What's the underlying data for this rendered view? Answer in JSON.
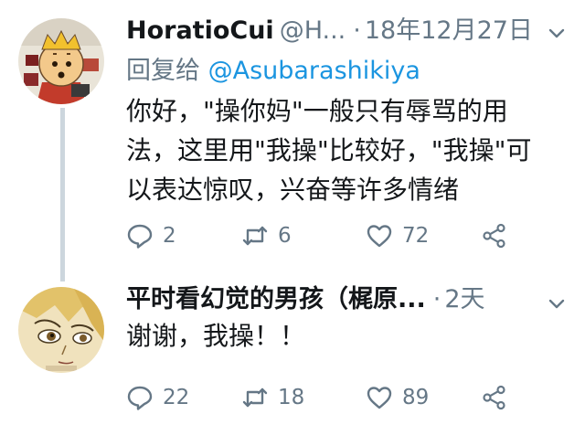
{
  "tweets": [
    {
      "name": "HoratioCui",
      "handle": "@H...",
      "separator": "·",
      "time": "18年12月27日",
      "reply_prefix": "回复给",
      "reply_to": "@Asubarashikiya",
      "text": "你好，\"操你妈\"一般只有辱骂的用法，这里用\"我操\"比较好，\"我操\"可以表达惊叹，兴奋等许多情绪",
      "replies": "2",
      "retweets": "6",
      "likes": "72",
      "icons": [
        "avatar-cartoon",
        "reply-icon",
        "retweet-icon",
        "like-icon",
        "share-icon",
        "chevron-down-icon"
      ]
    },
    {
      "name": "平时看幻觉的男孩（梶原...",
      "separator": "·",
      "time": "2天",
      "text": "谢谢，我操！！",
      "replies": "22",
      "retweets": "18",
      "likes": "89",
      "icons": [
        "avatar-anime",
        "reply-icon",
        "retweet-icon",
        "like-icon",
        "share-icon",
        "chevron-down-icon"
      ]
    }
  ],
  "colors": {
    "text": "#14171a",
    "secondary": "#657786",
    "link": "#1b95e0",
    "thread_line": "#ccd6dd"
  }
}
